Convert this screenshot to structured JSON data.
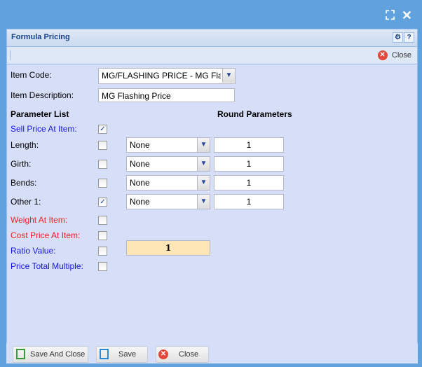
{
  "window": {
    "maximize_icon": "expand-icon",
    "close_icon": "close-icon"
  },
  "panel": {
    "title": "Formula Pricing",
    "gear_icon": "gear-icon",
    "help_label": "?"
  },
  "toolbar": {
    "close_label": "Close"
  },
  "form": {
    "item_code_label": "Item Code:",
    "item_code_value": "MG/FLASHING PRICE - MG Flash",
    "item_description_label": "Item Description:",
    "item_description_value": "MG Flashing Price",
    "parameter_list_heading": "Parameter List",
    "round_parameters_heading": "Round Parameters",
    "parameters": [
      {
        "label": "Sell Price At Item:",
        "checked": true
      },
      {
        "label": "Length:",
        "checked": false,
        "round": "None",
        "value": "1"
      },
      {
        "label": "Girth:",
        "checked": false,
        "round": "None",
        "value": "1"
      },
      {
        "label": "Bends:",
        "checked": false,
        "round": "None",
        "value": "1"
      },
      {
        "label": "Other 1:",
        "checked": true,
        "round": "None",
        "value": "1"
      },
      {
        "label": "Weight At Item:",
        "checked": false
      },
      {
        "label": "Cost Price At Item:",
        "checked": false
      },
      {
        "label": "Ratio Value:",
        "checked": false,
        "value": "1"
      },
      {
        "label": "Price Total Multiple:",
        "checked": false
      }
    ]
  },
  "footer": {
    "save_close_label": "Save And Close",
    "save_label": "Save",
    "close_label": "Close"
  },
  "check_glyph": "✓",
  "x_glyph": "✕"
}
